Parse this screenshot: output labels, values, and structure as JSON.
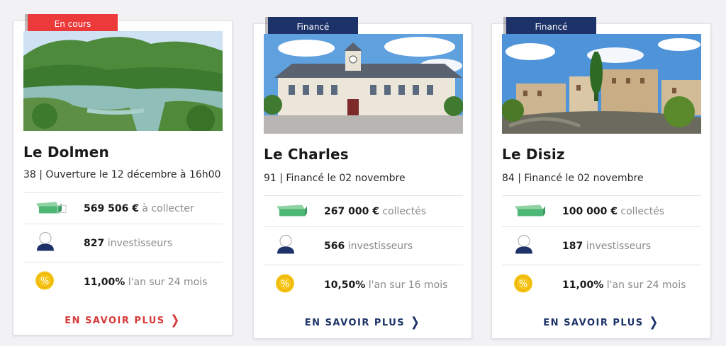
{
  "colors": {
    "red": "#ec3a3b",
    "navy": "#1c3268",
    "green": "#4cb774",
    "gold": "#f5c518"
  },
  "projects": [
    {
      "badge": "En cours",
      "title": "Le Dolmen",
      "subtitle": "38 | Ouverture le 12 décembre à 16h00",
      "amount": "569 506 €",
      "amount_label": "à collecter",
      "investors": "827",
      "investors_label": "investisseurs",
      "rate": "11,00%",
      "rate_label": "l'an sur 24 mois",
      "cta": "EN SAVOIR PLUS",
      "image_icon": "landscape-lake-photo"
    },
    {
      "badge": "Financé",
      "title": "Le Charles",
      "subtitle": "91 | Financé le 02 novembre",
      "amount": "267 000 €",
      "amount_label": "collectés",
      "investors": "566",
      "investors_label": "investisseurs",
      "rate": "10,50%",
      "rate_label": "l'an sur 16 mois",
      "cta": "EN SAVOIR PLUS",
      "image_icon": "town-hall-photo"
    },
    {
      "badge": "Financé",
      "title": "Le Disiz",
      "subtitle": "84 | Financé le 02 novembre",
      "amount": "100 000 €",
      "amount_label": "collectés",
      "investors": "187",
      "investors_label": "investisseurs",
      "rate": "11,00%",
      "rate_label": "l'an sur 24 mois",
      "cta": "EN SAVOIR PLUS",
      "image_icon": "village-bridge-photo"
    }
  ],
  "icons": {
    "amount": "banknote-stack-icon",
    "investors": "investor-person-icon",
    "rate": "percent-coin-icon",
    "cta": "chevron-right-icon"
  }
}
